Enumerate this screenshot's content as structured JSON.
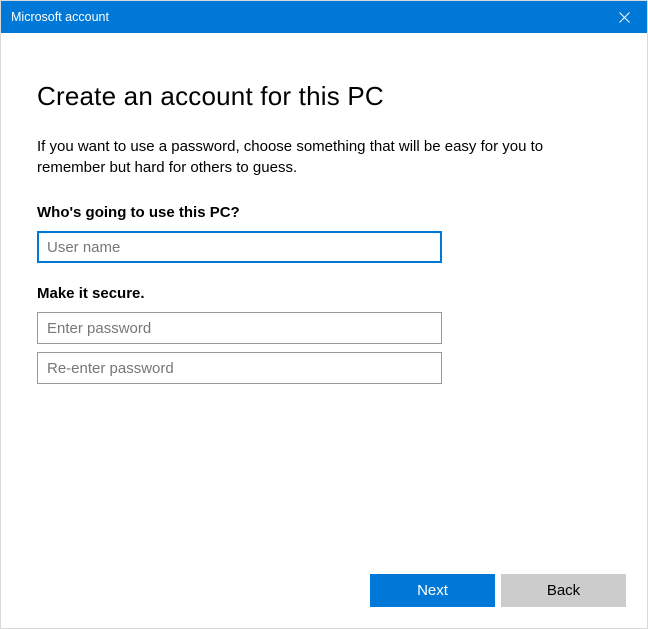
{
  "titlebar": {
    "title": "Microsoft account"
  },
  "main": {
    "heading": "Create an account for this PC",
    "subtext": "If you want to use a password, choose something that will be easy for you to remember but hard for others to guess.",
    "section_user_label": "Who's going to use this PC?",
    "username_placeholder": "User name",
    "section_secure_label": "Make it secure.",
    "password_placeholder": "Enter password",
    "reenter_placeholder": "Re-enter password"
  },
  "footer": {
    "next_label": "Next",
    "back_label": "Back"
  }
}
